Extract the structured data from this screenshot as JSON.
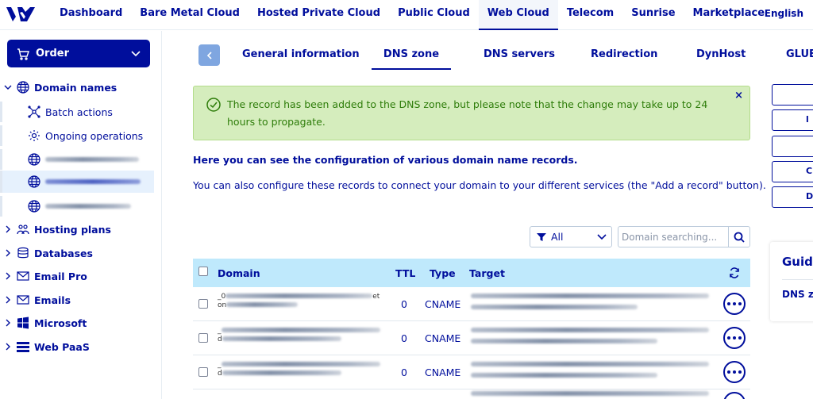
{
  "topbar": {
    "nav": [
      "Dashboard",
      "Bare Metal Cloud",
      "Hosted Private Cloud",
      "Public Cloud",
      "Web Cloud",
      "Telecom",
      "Sunrise",
      "Marketplace"
    ],
    "active": "Web Cloud",
    "language": "English"
  },
  "sidebar": {
    "order_label": "Order",
    "domain_names": "Domain names",
    "batch_actions": "Batch actions",
    "ongoing_operations": "Ongoing operations",
    "hosting_plans": "Hosting plans",
    "databases": "Databases",
    "email_pro": "Email Pro",
    "emails": "Emails",
    "microsoft": "Microsoft",
    "web_paas": "Web PaaS"
  },
  "tabs": [
    "General information",
    "DNS zone",
    "DNS servers",
    "Redirection",
    "DynHost",
    "GLUE"
  ],
  "active_tab": "DNS zone",
  "alert": {
    "text": "The record has been added to the DNS zone, but please note that the change may take up to 24 hours to propagate.",
    "close": "×"
  },
  "intro": {
    "heading": "Here you can see the configuration of various domain name records.",
    "text": "You can also configure these records to connect your domain to your different services (the \"Add a record\" button)."
  },
  "filter": {
    "selected": "All",
    "search_placeholder": "Domain searching..."
  },
  "table": {
    "headers": {
      "domain": "Domain",
      "ttl": "TTL",
      "type": "Type",
      "target": "Target"
    },
    "rows": [
      {
        "ttl": "0",
        "type": "CNAME",
        "domain_prefix_1": "_0",
        "domain_suffix_1": "et",
        "domain_prefix_2": "on"
      },
      {
        "ttl": "0",
        "type": "CNAME",
        "domain_prefix_1": "_",
        "domain_suffix_1": "",
        "domain_prefix_2": "d"
      },
      {
        "ttl": "0",
        "type": "CNAME",
        "domain_prefix_1": "_",
        "domain_suffix_1": "",
        "domain_prefix_2": "d"
      }
    ]
  },
  "right_panel": {
    "buttons": [
      "",
      "l",
      "",
      "C",
      "D"
    ],
    "guide_title": "Guide",
    "guide_link": "DNS zo"
  },
  "colors": {
    "brand": "#000e9c",
    "alert_bg": "#d5edbd",
    "table_header_bg": "#bfe9fc"
  }
}
